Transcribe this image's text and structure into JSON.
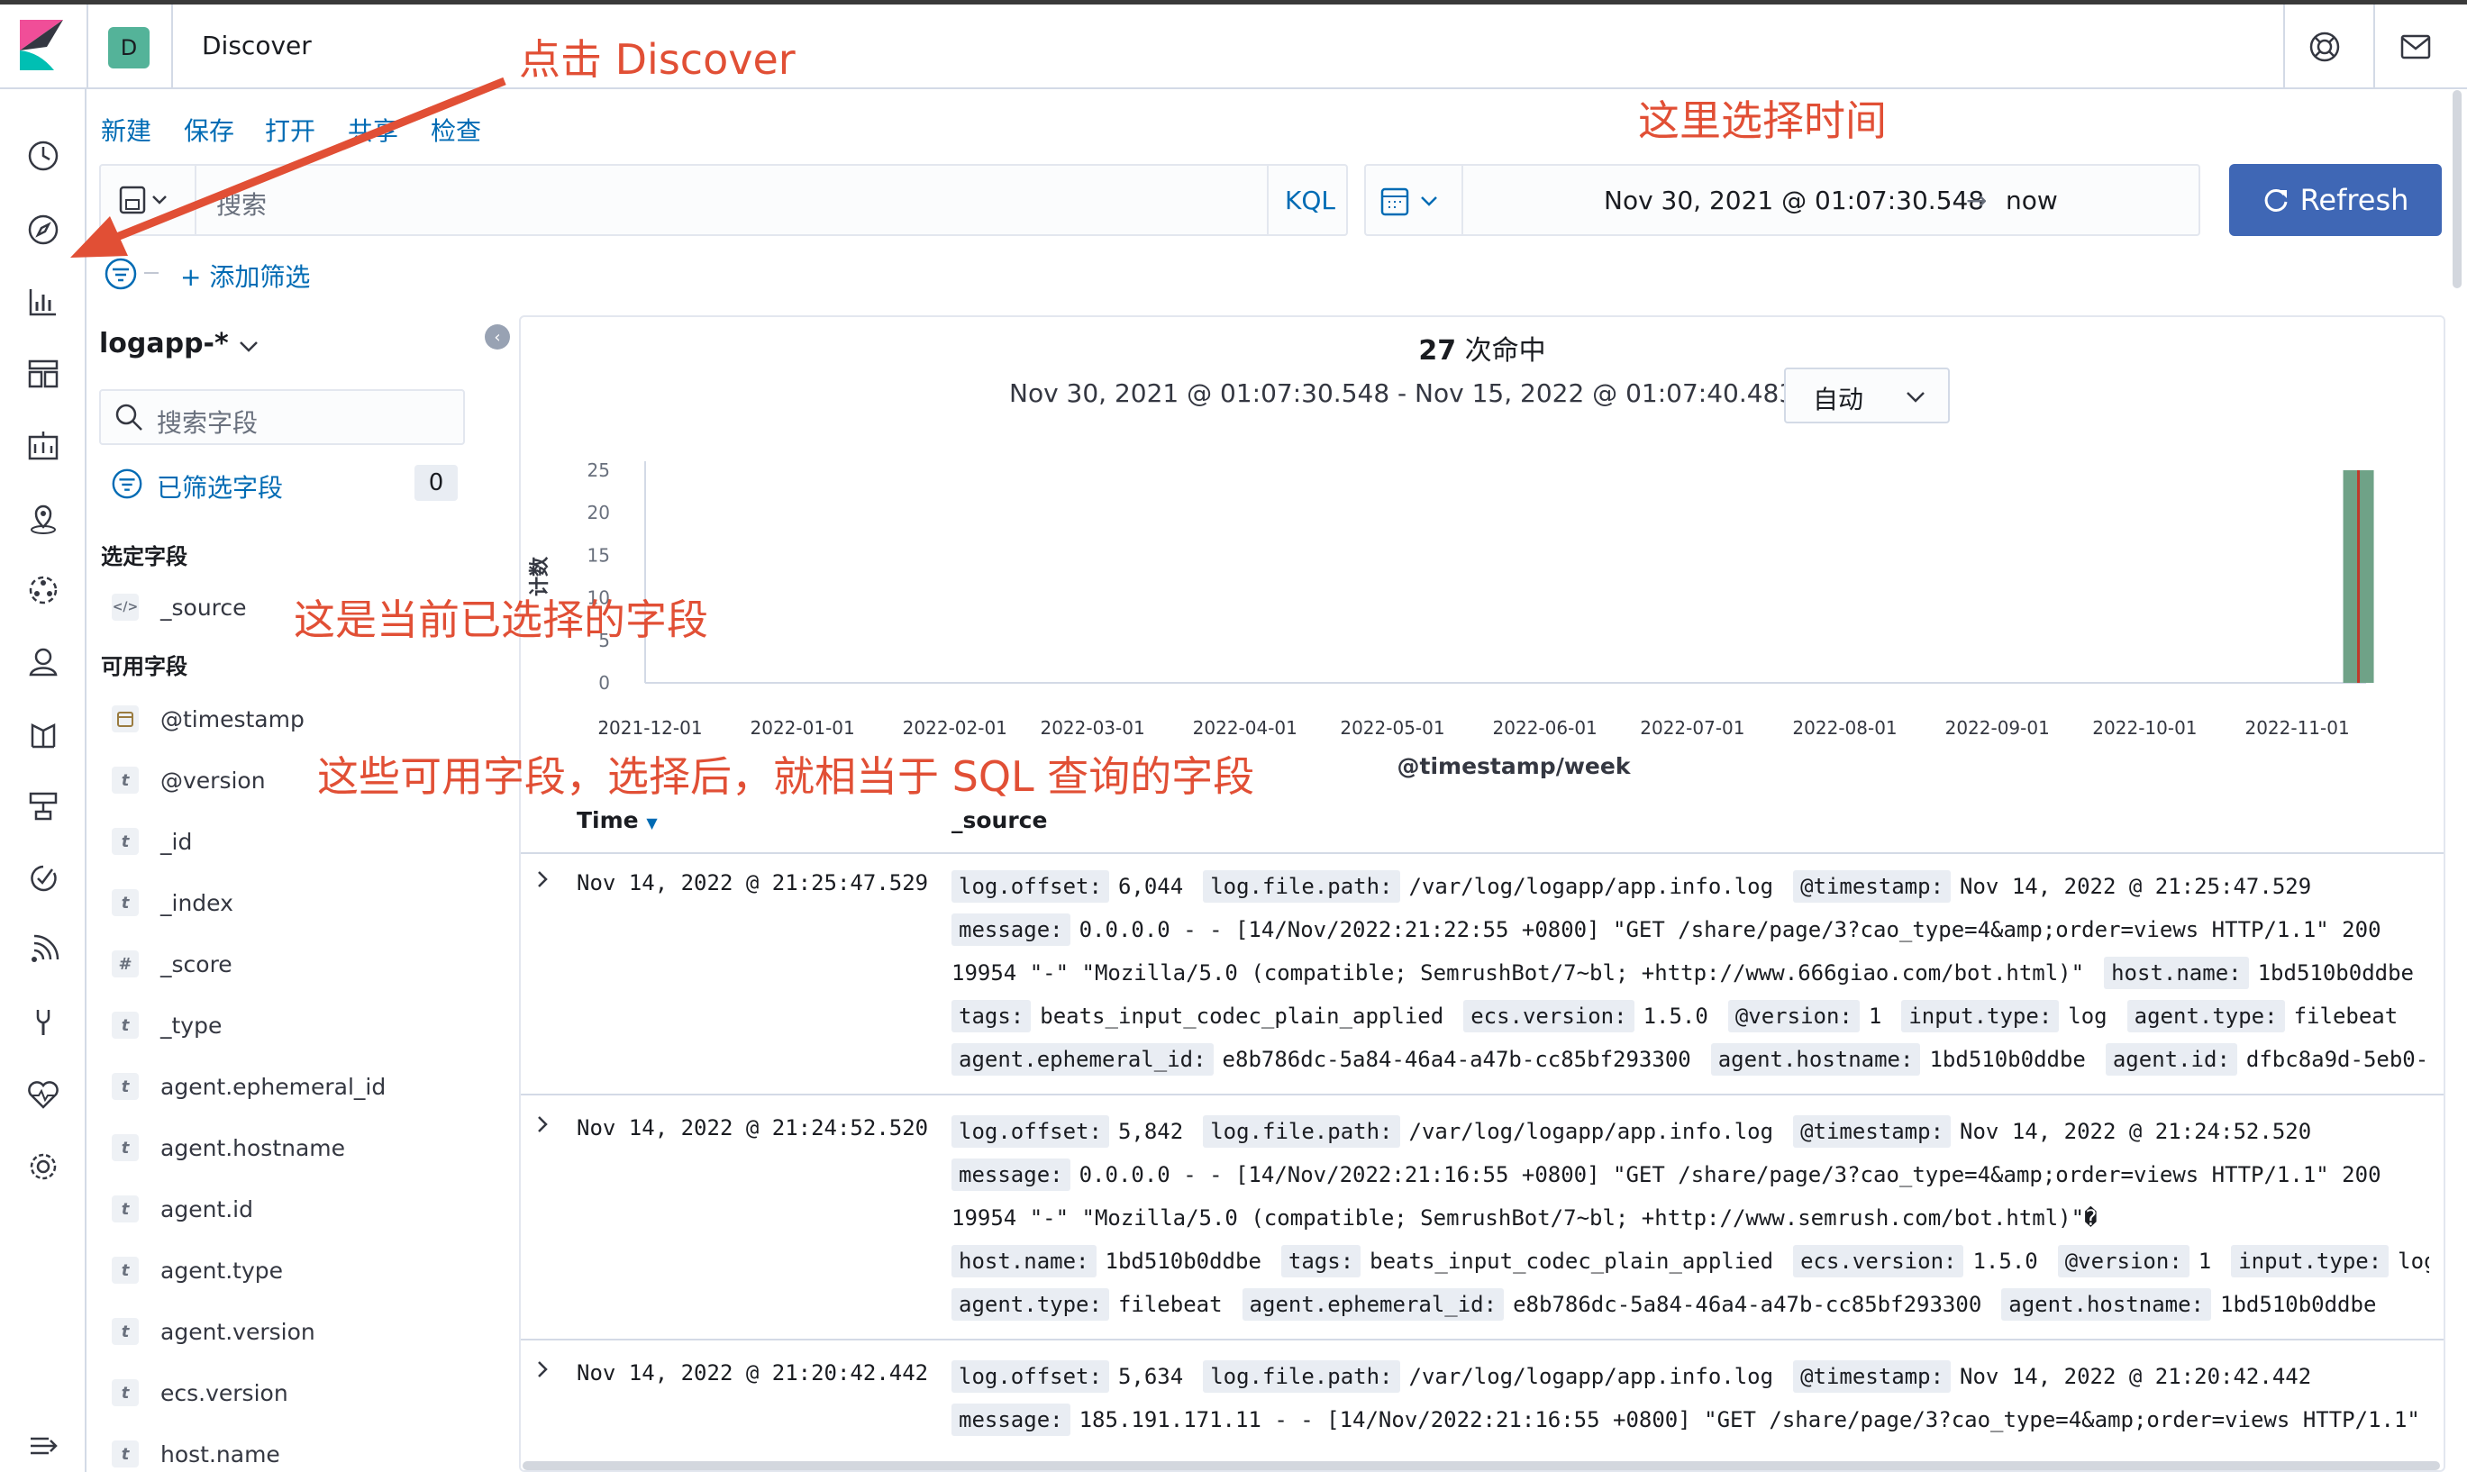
{
  "header": {
    "app_initial": "D",
    "app_title": "Discover"
  },
  "topmenu": [
    "新建",
    "保存",
    "打开",
    "共享",
    "检查"
  ],
  "querybar": {
    "placeholder": "搜索",
    "language": "KQL"
  },
  "timepicker": {
    "start": "Nov 30, 2021 @ 01:07:30.548",
    "arrow": "→",
    "end": "now",
    "refresh_label": "Refresh"
  },
  "filters": {
    "add_label": "+ 添加筛选"
  },
  "sidebar": {
    "index_pattern": "logapp-*",
    "search_placeholder": "搜索字段",
    "filtered_label": "已筛选字段",
    "filtered_count": "0",
    "selected_heading": "选定字段",
    "available_heading": "可用字段",
    "selected_fields": [
      {
        "token": "</>",
        "name": "_source"
      }
    ],
    "available_fields": [
      {
        "token": "cal",
        "name": "@timestamp"
      },
      {
        "token": "t",
        "name": "@version"
      },
      {
        "token": "t",
        "name": "_id"
      },
      {
        "token": "t",
        "name": "_index"
      },
      {
        "token": "#",
        "name": "_score"
      },
      {
        "token": "t",
        "name": "_type"
      },
      {
        "token": "t",
        "name": "agent.ephemeral_id"
      },
      {
        "token": "t",
        "name": "agent.hostname"
      },
      {
        "token": "t",
        "name": "agent.id"
      },
      {
        "token": "t",
        "name": "agent.type"
      },
      {
        "token": "t",
        "name": "agent.version"
      },
      {
        "token": "t",
        "name": "ecs.version"
      },
      {
        "token": "t",
        "name": "host.name"
      }
    ]
  },
  "summary": {
    "hits": "27",
    "hits_suffix": "次命中",
    "range": "Nov 30, 2021 @ 01:07:30.548 - Nov 15, 2022 @ 01:07:40.483 —",
    "interval": "自动"
  },
  "chart_data": {
    "type": "bar",
    "title": "",
    "xlabel": "@timestamp/week",
    "ylabel": "计数",
    "ylim": [
      0,
      25
    ],
    "yticks": [
      0,
      5,
      10,
      15,
      20,
      25
    ],
    "x_ticks": [
      "2021-12-01",
      "2022-01-01",
      "2022-02-01",
      "2022-03-01",
      "2022-04-01",
      "2022-05-01",
      "2022-06-01",
      "2022-07-01",
      "2022-08-01",
      "2022-09-01",
      "2022-10-01",
      "2022-11-01"
    ],
    "bars": [
      {
        "week": "2022-11-14",
        "value": 27
      }
    ],
    "bar_color": "#6fa287",
    "grid": false
  },
  "table": {
    "col_time": "Time",
    "col_source": "_source",
    "rows": [
      {
        "time": "Nov 14, 2022 @ 21:25:47.529",
        "lines": [
          [
            [
              "log.offset:",
              "6,044"
            ],
            [
              "log.file.path:",
              "/var/log/logapp/app.info.log"
            ],
            [
              "@timestamp:",
              "Nov 14, 2022 @ 21:25:47.529"
            ]
          ],
          [
            [
              "message:",
              "0.0.0.0 - - [14/Nov/2022:21:22:55 +0800] \"GET /share/page/3?cao_type=4&amp;order=views HTTP/1.1\" 200"
            ]
          ],
          [
            [
              "",
              "19954 \"-\" \"Mozilla/5.0 (compatible; SemrushBot/7~bl; +http://www.666giao.com/bot.html)\""
            ],
            [
              "host.name:",
              "1bd510b0ddbe"
            ]
          ],
          [
            [
              "tags:",
              "beats_input_codec_plain_applied"
            ],
            [
              "ecs.version:",
              "1.5.0"
            ],
            [
              "@version:",
              "1"
            ],
            [
              "input.type:",
              "log"
            ],
            [
              "agent.type:",
              "filebeat"
            ]
          ],
          [
            [
              "agent.ephemeral_id:",
              "e8b786dc-5a84-46a4-a47b-cc85bf293300"
            ],
            [
              "agent.hostname:",
              "1bd510b0ddbe"
            ],
            [
              "agent.id:",
              "dfbc8a9d-5eb0-"
            ]
          ]
        ]
      },
      {
        "time": "Nov 14, 2022 @ 21:24:52.520",
        "lines": [
          [
            [
              "log.offset:",
              "5,842"
            ],
            [
              "log.file.path:",
              "/var/log/logapp/app.info.log"
            ],
            [
              "@timestamp:",
              "Nov 14, 2022 @ 21:24:52.520"
            ]
          ],
          [
            [
              "message:",
              "0.0.0.0 - - [14/Nov/2022:21:16:55 +0800] \"GET /share/page/3?cao_type=4&amp;order=views HTTP/1.1\" 200"
            ]
          ],
          [
            [
              "",
              "19954 \"-\" \"Mozilla/5.0 (compatible; SemrushBot/7~bl; +http://www.semrush.com/bot.html)\"�"
            ]
          ],
          [
            [
              "host.name:",
              "1bd510b0ddbe"
            ],
            [
              "tags:",
              "beats_input_codec_plain_applied"
            ],
            [
              "ecs.version:",
              "1.5.0"
            ],
            [
              "@version:",
              "1"
            ],
            [
              "input.type:",
              "log"
            ]
          ],
          [
            [
              "agent.type:",
              "filebeat"
            ],
            [
              "agent.ephemeral_id:",
              "e8b786dc-5a84-46a4-a47b-cc85bf293300"
            ],
            [
              "agent.hostname:",
              "1bd510b0ddbe"
            ]
          ]
        ]
      },
      {
        "time": "Nov 14, 2022 @ 21:20:42.442",
        "lines": [
          [
            [
              "log.offset:",
              "5,634"
            ],
            [
              "log.file.path:",
              "/var/log/logapp/app.info.log"
            ],
            [
              "@timestamp:",
              "Nov 14, 2022 @ 21:20:42.442"
            ]
          ],
          [
            [
              "message:",
              "185.191.171.11 - - [14/Nov/2022:21:16:55 +0800] \"GET /share/page/3?cao_type=4&amp;order=views HTTP/1.1\""
            ]
          ]
        ]
      }
    ]
  },
  "annotations": {
    "discover": "点击 Discover",
    "time": "这里选择时间",
    "selected": "这是当前已选择的字段",
    "available": "这些可用字段，选择后，就相当于 SQL 查询的字段"
  },
  "colors": {
    "accent": "#006bb4",
    "refresh": "#3f67b5",
    "annotation": "#e14f35",
    "app_avatar": "#54b399"
  }
}
